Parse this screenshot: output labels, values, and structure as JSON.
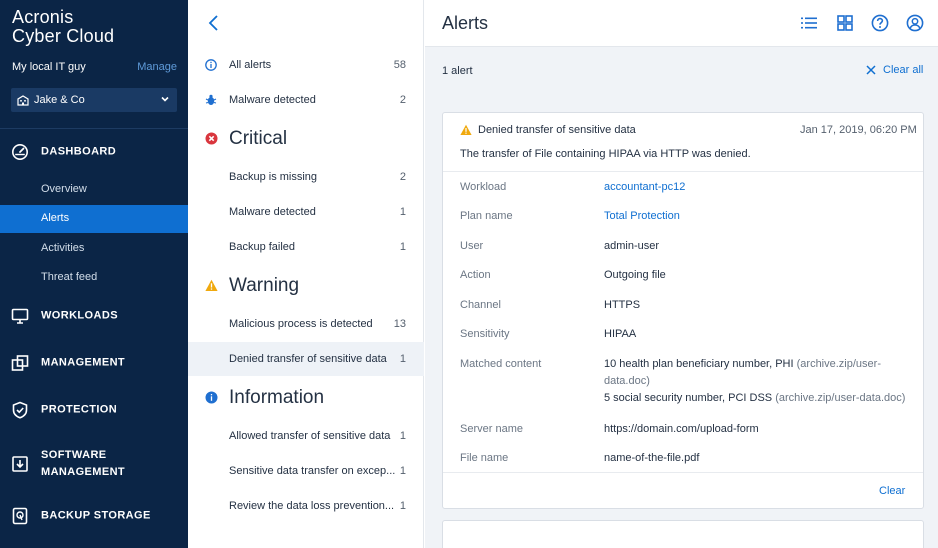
{
  "brand": {
    "line1": "Acronis",
    "line2": "Cyber Cloud"
  },
  "account": {
    "name": "My local IT guy",
    "manage_label": "Manage"
  },
  "tenant": {
    "name": "Jake & Co"
  },
  "sidebar": {
    "sections": [
      {
        "label": "DASHBOARD",
        "icon": "dashboard-gauge-icon"
      },
      {
        "label": "WORKLOADS",
        "icon": "monitor-icon"
      },
      {
        "label": "MANAGEMENT",
        "icon": "management-icon"
      },
      {
        "label": "PROTECTION",
        "icon": "shield-icon"
      },
      {
        "label": "SOFTWARE",
        "label2": "MANAGEMENT",
        "icon": "software-download-icon"
      },
      {
        "label": "BACKUP STORAGE",
        "icon": "storage-icon"
      }
    ],
    "dashboard_items": [
      {
        "label": "Overview"
      },
      {
        "label": "Alerts",
        "active": true
      },
      {
        "label": "Activities"
      },
      {
        "label": "Threat feed"
      }
    ]
  },
  "alert_list": {
    "all": {
      "label": "All alerts",
      "count": "58"
    },
    "malware_top": {
      "label": "Malware detected",
      "count": "2"
    },
    "groups": [
      {
        "title": "Critical",
        "items": [
          {
            "label": "Backup is missing",
            "count": "2"
          },
          {
            "label": "Malware detected",
            "count": "1"
          },
          {
            "label": "Backup failed",
            "count": "1"
          }
        ]
      },
      {
        "title": "Warning",
        "items": [
          {
            "label": "Malicious process is detected",
            "count": "13"
          },
          {
            "label": "Denied transfer of sensitive data",
            "count": "1",
            "selected": true
          }
        ]
      },
      {
        "title": "Information",
        "items": [
          {
            "label": "Allowed transfer of sensitive data",
            "count": "1"
          },
          {
            "label": "Sensitive data transfer on excep...",
            "count": "1"
          },
          {
            "label": "Review the data loss prevention...",
            "count": "1"
          }
        ]
      }
    ]
  },
  "header": {
    "title": "Alerts",
    "icons": [
      "list-view-icon",
      "grid-view-icon",
      "help-icon",
      "user-account-icon"
    ]
  },
  "summary": {
    "count_text": "1 alert",
    "clear_all_label": "Clear all"
  },
  "alert_card": {
    "title": "Denied transfer of sensitive data",
    "date": "Jan 17, 2019, 06:20 PM",
    "description": "The transfer of File containing HIPAA via HTTP was denied.",
    "fields": {
      "workload": {
        "label": "Workload",
        "value": "accountant-pc12"
      },
      "plan": {
        "label": "Plan name",
        "value": "Total Protection"
      },
      "user": {
        "label": "User",
        "value": "admin-user"
      },
      "action": {
        "label": "Action",
        "value": "Outgoing file"
      },
      "channel": {
        "label": "Channel",
        "value": "HTTPS"
      },
      "sensitivity": {
        "label": "Sensitivity",
        "value": "HIPAA"
      },
      "matched": {
        "label": "Matched content",
        "line1_main": "10 health plan beneficiary number, PHI ",
        "line1_src": "(archive.zip/user-data.doc)",
        "line2_main": "5 social security number, PCI DSS ",
        "line2_src": "(archive.zip/user-data.doc)"
      },
      "server": {
        "label": "Server name",
        "value": "https://domain.com/upload-form"
      },
      "file": {
        "label": "File name",
        "value": "name-of-the-file.pdf"
      }
    },
    "clear_label": "Clear"
  },
  "colors": {
    "sidebar_bg": "#0b2546",
    "accent": "#0f6fd1",
    "critical": "#d9363e",
    "warning": "#f0a90e",
    "info": "#1f6fd0"
  }
}
